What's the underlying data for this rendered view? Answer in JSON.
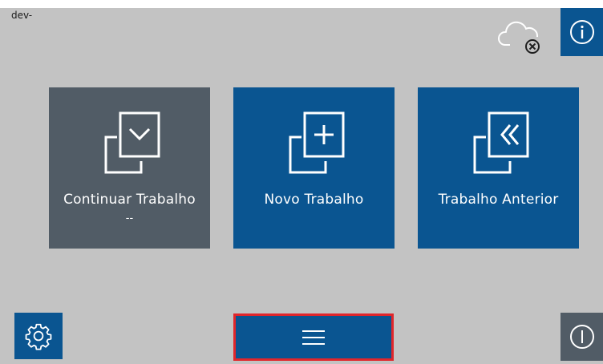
{
  "header": {
    "device_label": "dev-"
  },
  "icons": {
    "cloud": "cloud-offline-icon",
    "info": "info-icon",
    "settings": "gear-icon",
    "menu": "hamburger-menu-icon",
    "power": "power-icon"
  },
  "tiles": [
    {
      "label": "Continuar Trabalho",
      "sub": "--",
      "icon": "copy-chevron-down-icon",
      "color": "#515c66"
    },
    {
      "label": "Novo Trabalho",
      "sub": "",
      "icon": "copy-plus-icon",
      "color": "#0a5591"
    },
    {
      "label": "Trabalho Anterior",
      "sub": "",
      "icon": "copy-double-left-icon",
      "color": "#0a5591"
    }
  ],
  "colors": {
    "background": "#c3c3c3",
    "primary": "#0a5591",
    "secondary": "#515c66",
    "highlight": "#e0262b"
  }
}
